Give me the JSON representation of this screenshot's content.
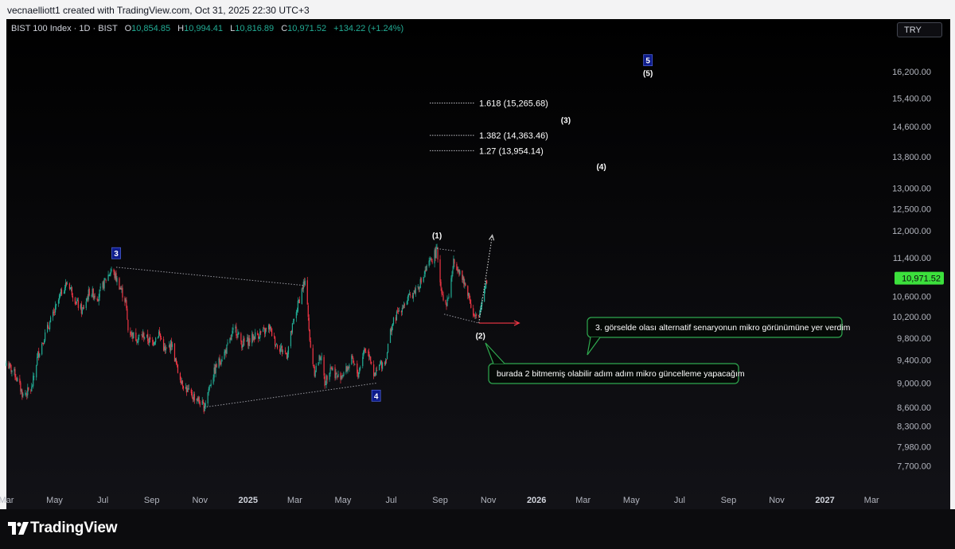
{
  "header": {
    "text": "vecnaelliott1 created with TradingView.com, Oct 31, 2025 22:30 UTC+3"
  },
  "legend": {
    "symbol": "BIST 100 Index · 1D · BIST",
    "o_label": "O",
    "o_value": "10,854.85",
    "h_label": "H",
    "h_value": "10,994.41",
    "l_label": "L",
    "l_value": "10,816.89",
    "c_label": "C",
    "c_value": "10,971.52",
    "change": "+134.22 (+1.24%)"
  },
  "currency_button": "TRY",
  "footer": {
    "brand": "TradingView"
  },
  "colors": {
    "up": "#22ab94",
    "down": "#f23645",
    "price_tag": "#3ce03c",
    "annotation_border": "#2fa84f"
  },
  "chart_data": {
    "type": "candlestick",
    "title": "BIST 100 Index · 1D · BIST",
    "y_scale": "log",
    "ylim": [
      7400,
      17200
    ],
    "xlim": [
      "2024-03-01",
      "2027-03-20"
    ],
    "y_ticks": [
      16200,
      15400,
      14600,
      13800,
      13000,
      12500,
      12000,
      11400,
      10600,
      10200,
      9800,
      9400,
      9000,
      8600,
      8300,
      7980,
      7700
    ],
    "y_tick_labels": [
      "16,200.00",
      "15,400.00",
      "14,600.00",
      "13,800.00",
      "13,000.00",
      "12,500.00",
      "12,000.00",
      "11,400.00",
      "10,600.00",
      "10,200.00",
      "9,800.00",
      "9,400.00",
      "9,000.00",
      "8,600.00",
      "8,300.00",
      "7,980.00",
      "7,700.00"
    ],
    "x_ticks": [
      {
        "date": "2024-03-01",
        "label": "Mar",
        "bold": false
      },
      {
        "date": "2024-05-01",
        "label": "May",
        "bold": false
      },
      {
        "date": "2024-07-01",
        "label": "Jul",
        "bold": false
      },
      {
        "date": "2024-09-01",
        "label": "Sep",
        "bold": false
      },
      {
        "date": "2024-11-01",
        "label": "Nov",
        "bold": false
      },
      {
        "date": "2025-01-01",
        "label": "2025",
        "bold": true
      },
      {
        "date": "2025-03-01",
        "label": "Mar",
        "bold": false
      },
      {
        "date": "2025-05-01",
        "label": "May",
        "bold": false
      },
      {
        "date": "2025-07-01",
        "label": "Jul",
        "bold": false
      },
      {
        "date": "2025-09-01",
        "label": "Sep",
        "bold": false
      },
      {
        "date": "2025-11-01",
        "label": "Nov",
        "bold": false
      },
      {
        "date": "2026-01-01",
        "label": "2026",
        "bold": true
      },
      {
        "date": "2026-03-01",
        "label": "Mar",
        "bold": false
      },
      {
        "date": "2026-05-01",
        "label": "May",
        "bold": false
      },
      {
        "date": "2026-07-01",
        "label": "Jul",
        "bold": false
      },
      {
        "date": "2026-09-01",
        "label": "Sep",
        "bold": false
      },
      {
        "date": "2026-11-01",
        "label": "Nov",
        "bold": false
      },
      {
        "date": "2027-01-01",
        "label": "2027",
        "bold": true
      },
      {
        "date": "2027-03-01",
        "label": "Mar",
        "bold": false
      }
    ],
    "close_path": [
      [
        "2024-03-01",
        9350
      ],
      [
        "2024-03-12",
        9150
      ],
      [
        "2024-03-22",
        8800
      ],
      [
        "2024-04-02",
        8900
      ],
      [
        "2024-04-10",
        9500
      ],
      [
        "2024-04-20",
        9900
      ],
      [
        "2024-05-01",
        10300
      ],
      [
        "2024-05-10",
        10700
      ],
      [
        "2024-05-18",
        10900
      ],
      [
        "2024-05-28",
        10500
      ],
      [
        "2024-06-05",
        10300
      ],
      [
        "2024-06-14",
        10700
      ],
      [
        "2024-06-25",
        10600
      ],
      [
        "2024-07-05",
        10950
      ],
      [
        "2024-07-12",
        11150
      ],
      [
        "2024-07-20",
        10900
      ],
      [
        "2024-07-30",
        10500
      ],
      [
        "2024-08-02",
        9950
      ],
      [
        "2024-08-12",
        9800
      ],
      [
        "2024-08-22",
        9850
      ],
      [
        "2024-09-01",
        9700
      ],
      [
        "2024-09-10",
        9900
      ],
      [
        "2024-09-18",
        9550
      ],
      [
        "2024-09-26",
        9700
      ],
      [
        "2024-10-04",
        9200
      ],
      [
        "2024-10-12",
        8950
      ],
      [
        "2024-10-20",
        8800
      ],
      [
        "2024-10-28",
        8750
      ],
      [
        "2024-11-06",
        8600
      ],
      [
        "2024-11-14",
        9000
      ],
      [
        "2024-11-22",
        9300
      ],
      [
        "2024-12-01",
        9500
      ],
      [
        "2024-12-08",
        9700
      ],
      [
        "2024-12-15",
        10000
      ],
      [
        "2024-12-24",
        9700
      ],
      [
        "2025-01-02",
        9750
      ],
      [
        "2025-01-10",
        9850
      ],
      [
        "2025-01-20",
        9900
      ],
      [
        "2025-01-28",
        10000
      ],
      [
        "2025-02-05",
        9700
      ],
      [
        "2025-02-12",
        9600
      ],
      [
        "2025-02-19",
        9500
      ],
      [
        "2025-02-26",
        10000
      ],
      [
        "2025-03-06",
        10500
      ],
      [
        "2025-03-12",
        10850
      ],
      [
        "2025-03-16",
        10800
      ],
      [
        "2025-03-20",
        9700
      ],
      [
        "2025-03-26",
        9200
      ],
      [
        "2025-04-03",
        9500
      ],
      [
        "2025-04-08",
        9000
      ],
      [
        "2025-04-15",
        9300
      ],
      [
        "2025-04-24",
        9100
      ],
      [
        "2025-05-04",
        9200
      ],
      [
        "2025-05-12",
        9400
      ],
      [
        "2025-05-20",
        9150
      ],
      [
        "2025-05-28",
        9600
      ],
      [
        "2025-06-04",
        9500
      ],
      [
        "2025-06-10",
        9100
      ],
      [
        "2025-06-16",
        9300
      ],
      [
        "2025-06-24",
        9400
      ],
      [
        "2025-07-01",
        10000
      ],
      [
        "2025-07-10",
        10300
      ],
      [
        "2025-07-20",
        10500
      ],
      [
        "2025-07-30",
        10700
      ],
      [
        "2025-08-08",
        10900
      ],
      [
        "2025-08-16",
        11200
      ],
      [
        "2025-08-24",
        11450
      ],
      [
        "2025-08-28",
        11550
      ],
      [
        "2025-09-02",
        10800
      ],
      [
        "2025-09-08",
        10400
      ],
      [
        "2025-09-13",
        10700
      ],
      [
        "2025-09-18",
        11300
      ],
      [
        "2025-09-24",
        11200
      ],
      [
        "2025-09-30",
        10900
      ],
      [
        "2025-10-06",
        10700
      ],
      [
        "2025-10-14",
        10200
      ],
      [
        "2025-10-20",
        10150
      ],
      [
        "2025-10-24",
        10550
      ],
      [
        "2025-10-28",
        10850
      ],
      [
        "2025-10-31",
        10971
      ]
    ],
    "last_price": 10971.52,
    "last_price_label": "10,971.52",
    "wave_labels": [
      {
        "text": "3",
        "date": "2024-07-18",
        "price": 11500,
        "boxed": true
      },
      {
        "text": "4",
        "date": "2025-06-12",
        "price": 8790,
        "boxed": true
      },
      {
        "text": "5",
        "date": "2026-05-22",
        "price": 16550,
        "boxed": true
      },
      {
        "text": "(1)",
        "date": "2025-08-28",
        "price": 11900,
        "boxed": false
      },
      {
        "text": "(2)",
        "date": "2025-10-22",
        "price": 9850,
        "boxed": false
      },
      {
        "text": "(3)",
        "date": "2026-02-07",
        "price": 14790,
        "boxed": false
      },
      {
        "text": "(4)",
        "date": "2026-03-24",
        "price": 13550,
        "boxed": false
      },
      {
        "text": "(5)",
        "date": "2026-05-22",
        "price": 16160,
        "boxed": false
      }
    ],
    "fib_levels": [
      {
        "label": "1.618 (15,265.68)",
        "price": 15265.68
      },
      {
        "label": "1.382 (14,363.46)",
        "price": 14363.46
      },
      {
        "label": "1.27 (13,954.14)",
        "price": 13954.14
      }
    ],
    "trendlines": [
      {
        "from": [
          "2024-07-18",
          11200
        ],
        "to": [
          "2025-03-14",
          10820
        ],
        "style": "dotted"
      },
      {
        "from": [
          "2024-11-06",
          8600
        ],
        "to": [
          "2025-06-12",
          9000
        ],
        "style": "dotted"
      },
      {
        "from": [
          "2025-08-28",
          11600
        ],
        "to": [
          "2025-09-20",
          11550
        ],
        "style": "dotted"
      },
      {
        "from": [
          "2025-09-06",
          10250
        ],
        "to": [
          "2025-10-20",
          10080
        ],
        "style": "dotted"
      }
    ],
    "arrows": [
      {
        "from": [
          "2025-10-20",
          10080
        ],
        "to": [
          "2025-11-06",
          11900
        ],
        "style": "dotted",
        "color": "#c8c8c8"
      },
      {
        "from": [
          "2025-10-20",
          10080
        ],
        "to": [
          "2025-12-10",
          10080
        ],
        "style": "solid",
        "color": "#f23645"
      }
    ],
    "annotations": [
      {
        "text": "3. görselde olası alternatif senaryonun mikro görünümüne yer verdim"
      },
      {
        "text": "burada 2 bitmemiş olabilir adım adım mikro güncelleme yapacağım"
      }
    ]
  }
}
